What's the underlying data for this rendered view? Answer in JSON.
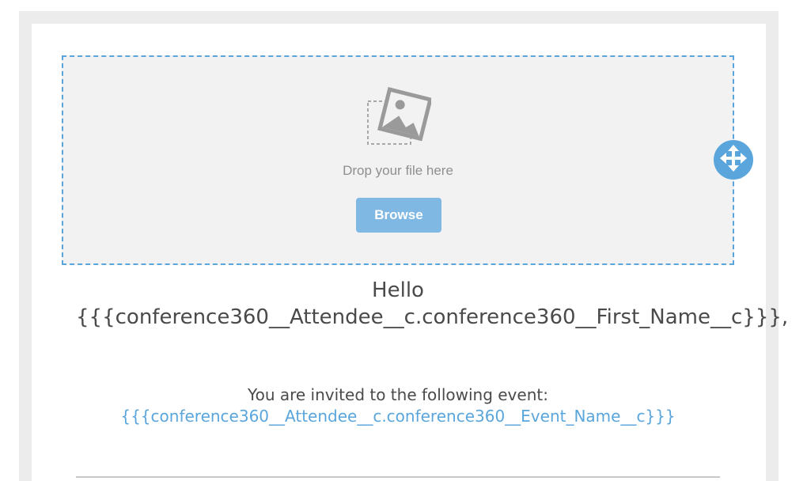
{
  "dropzone": {
    "drop_text": "Drop your file here",
    "browse_label": "Browse",
    "icon": "image-placeholder-icon"
  },
  "move_handle": {
    "icon": "move-arrows-icon"
  },
  "email": {
    "greeting": "Hello {{{conference360__Attendee__c.conference360__First_Name__c}}},",
    "invite_text": "You are invited to the following event:",
    "event_link": "{{{conference360__Attendee__c.conference360__Event_Name__c}}}"
  },
  "colors": {
    "accent": "#5aa6dc",
    "button": "#7fb8e3",
    "text": "#4a4a4a"
  }
}
